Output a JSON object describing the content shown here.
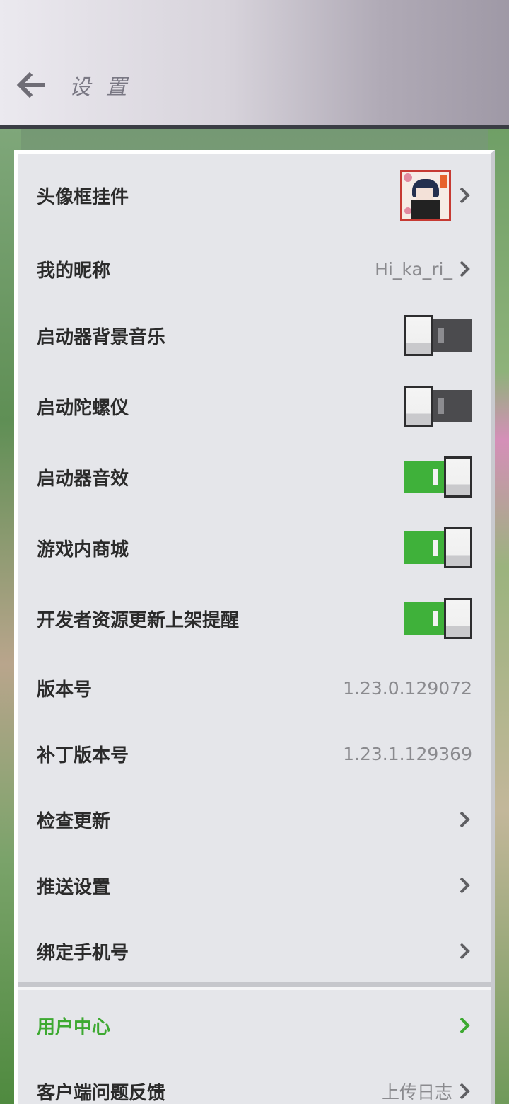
{
  "header": {
    "title": "设 置"
  },
  "settings": {
    "avatar_frame": {
      "label": "头像框挂件"
    },
    "nickname": {
      "label": "我的昵称",
      "value": "Hi_ka_ri_"
    },
    "bg_music": {
      "label": "启动器背景音乐",
      "state": "off"
    },
    "gyroscope": {
      "label": "启动陀螺仪",
      "state": "off"
    },
    "sound_effects": {
      "label": "启动器音效",
      "state": "on"
    },
    "in_game_store": {
      "label": "游戏内商城",
      "state": "on"
    },
    "dev_update_reminder": {
      "label": "开发者资源更新上架提醒",
      "state": "on"
    },
    "version": {
      "label": "版本号",
      "value": "1.23.0.129072"
    },
    "patch_version": {
      "label": "补丁版本号",
      "value": "1.23.1.129369"
    },
    "check_update": {
      "label": "检查更新"
    },
    "push_settings": {
      "label": "推送设置"
    },
    "bind_phone": {
      "label": "绑定手机号"
    }
  },
  "section2": {
    "user_center": {
      "label": "用户中心"
    },
    "feedback": {
      "label": "客户端问题反馈",
      "value": "上传日志"
    }
  },
  "colors": {
    "accent_green": "#3da931",
    "toggle_on": "#3fb13a",
    "toggle_off": "#4b4b4e",
    "panel_bg": "#e5e6ea"
  },
  "icons": [
    "back-arrow-icon",
    "chevron-right-icon"
  ]
}
